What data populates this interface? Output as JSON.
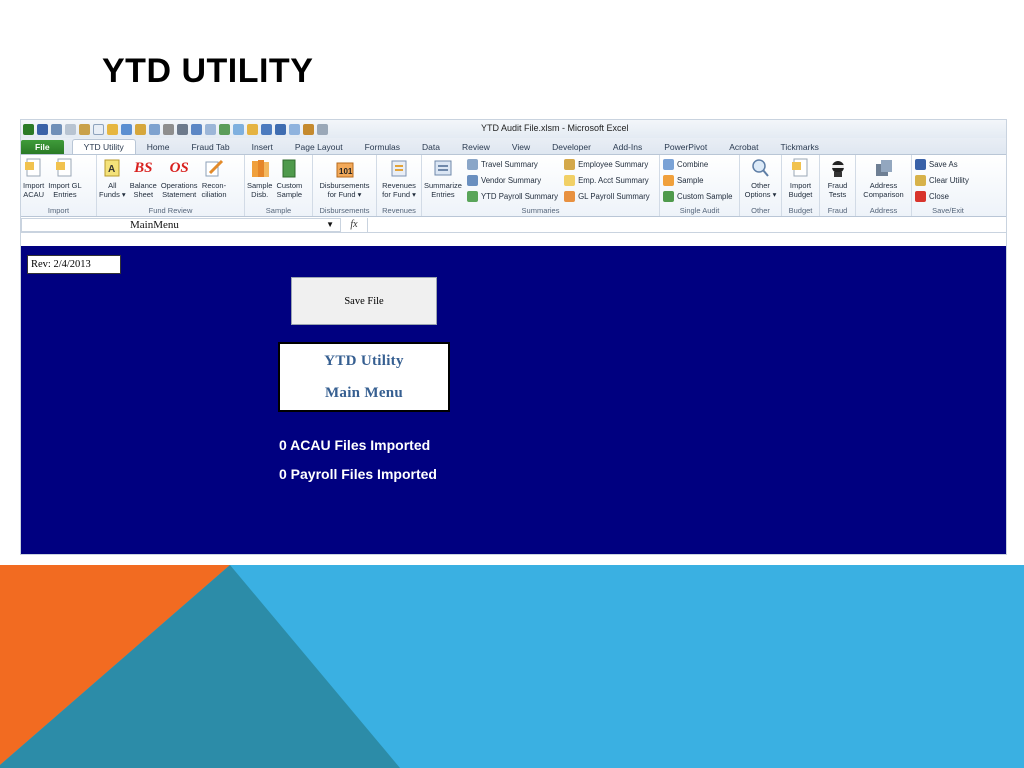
{
  "slide": {
    "title": "YTD UTILITY"
  },
  "window": {
    "title": "YTD Audit File.xlsm  -  Microsoft Excel"
  },
  "tabs": [
    "File",
    "YTD Utility",
    "Home",
    "Fraud Tab",
    "Insert",
    "Page Layout",
    "Formulas",
    "Data",
    "Review",
    "View",
    "Developer",
    "Add-Ins",
    "PowerPivot",
    "Acrobat",
    "Tickmarks"
  ],
  "ribbon": {
    "import": {
      "label": "Import",
      "btn1": [
        "Import",
        "ACAU"
      ],
      "btn2": [
        "Import GL",
        "Entries"
      ]
    },
    "fund_review": {
      "label": "Fund Review",
      "all": [
        "All",
        "Funds ▾"
      ],
      "bs": [
        "Balance",
        "Sheet"
      ],
      "os": [
        "Operations",
        "Statement"
      ],
      "recon": [
        "Recon-",
        "ciliation"
      ],
      "bs_icon": "BS",
      "os_icon": "OS"
    },
    "sample": {
      "label": "Sample",
      "disb": [
        "Sample",
        "Disb."
      ],
      "custom": [
        "Custom",
        "Sample"
      ]
    },
    "disbursements": {
      "label": "Disbursements",
      "btn": [
        "Disbursements",
        "for Fund ▾"
      ],
      "icon_text": "101"
    },
    "revenues": {
      "label": "Revenues",
      "btn": [
        "Revenues",
        "for Fund ▾"
      ]
    },
    "summaries": {
      "label": "Summaries",
      "summarize": [
        "Summarize",
        "Entries"
      ],
      "col1": [
        "Travel Summary",
        "Vendor Summary",
        "YTD Payroll Summary"
      ],
      "col2": [
        "Employee Summary",
        "Emp. Acct Summary",
        "GL Payroll Summary"
      ]
    },
    "single_audit": {
      "label": "Single Audit",
      "items": [
        "Combine",
        "Sample",
        "Custom Sample"
      ]
    },
    "other": {
      "label": "Other",
      "btn": [
        "Other",
        "Options ▾"
      ]
    },
    "budget": {
      "label": "Budget",
      "btn": [
        "Import",
        "Budget"
      ]
    },
    "fraud": {
      "label": "Fraud",
      "btn": [
        "Fraud",
        "Tests"
      ]
    },
    "address": {
      "label": "Address",
      "btn": [
        "Address",
        "Comparison"
      ]
    },
    "save_exit": {
      "label": "Save/Exit",
      "items": [
        "Save As",
        "Clear Utility",
        "Close"
      ]
    }
  },
  "formula_bar": {
    "name_box": "MainMenu",
    "fx": "fx",
    "content": ""
  },
  "sheet": {
    "rev": "Rev:  2/4/2013",
    "save_button": "Save File",
    "menu_title_1": "YTD Utility",
    "menu_title_2": "Main Menu",
    "acau_count": "0 ACAU Files Imported",
    "payroll_count": "0 Payroll Files Imported"
  },
  "colors": {
    "sheet_bg": "#000080",
    "deco_orange": "#f26b21",
    "deco_blue": "#3ab0e2",
    "deco_teal": "#2c8ca8"
  }
}
